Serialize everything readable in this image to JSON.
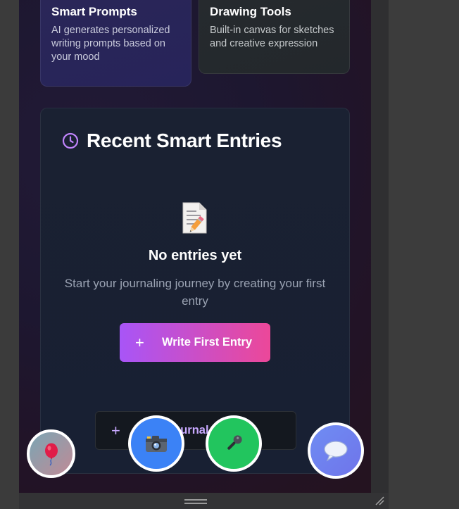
{
  "features": [
    {
      "title": "Smart Prompts",
      "description": "AI generates personalized writing prompts based on your mood"
    },
    {
      "title": "Drawing Tools",
      "description": "Built-in canvas for sketches and creative expression"
    }
  ],
  "recent": {
    "title": "Recent Smart Entries",
    "icon": "clock-icon",
    "empty_icon": "memo-icon",
    "empty_title": "No entries yet",
    "empty_description": "Start your journaling journey by creating your first entry",
    "primary_button": {
      "icon": "+",
      "label": "Write First Entry"
    },
    "secondary_button": {
      "icon": "+",
      "label": "Your Journal Book"
    }
  },
  "fabs": [
    {
      "name": "balloon-icon"
    },
    {
      "name": "camera-icon"
    },
    {
      "name": "microphone-icon"
    },
    {
      "name": "speech-bubble-icon"
    }
  ],
  "colors": {
    "accent_purple": "#a855f7",
    "accent_pink": "#ec4899",
    "camera_blue": "#3b82f6",
    "mic_green": "#22c55e"
  }
}
